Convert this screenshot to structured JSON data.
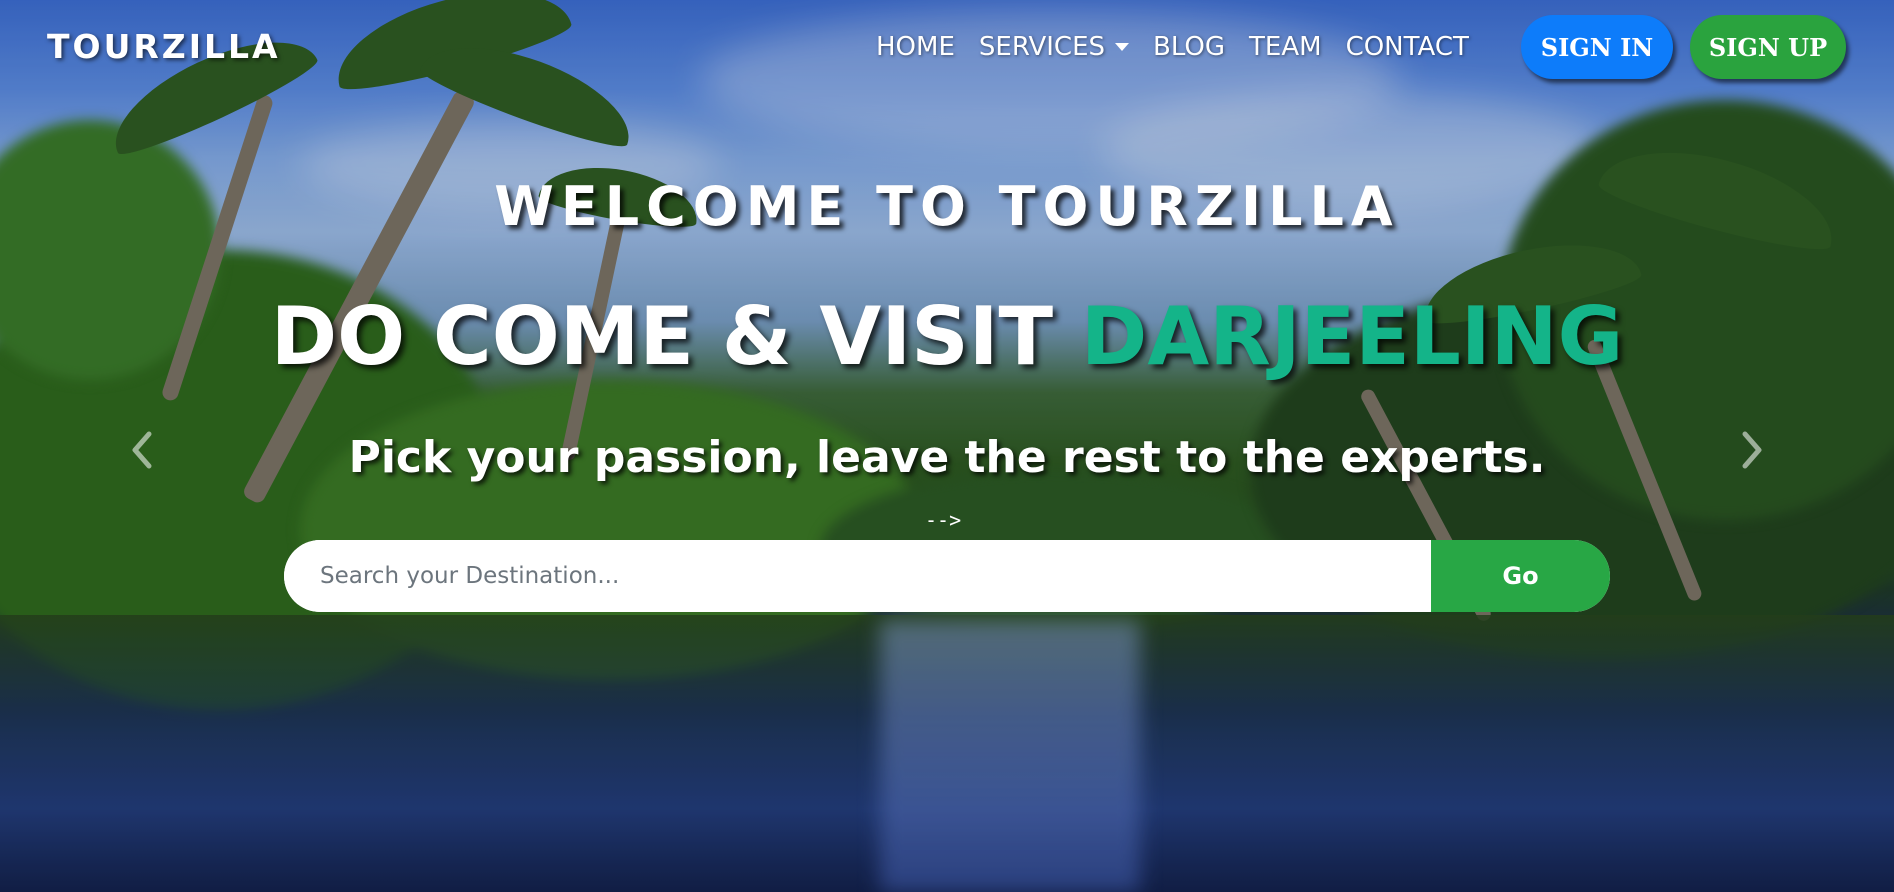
{
  "brand": "TOURZILLA",
  "nav": {
    "items": [
      {
        "label": "HOME"
      },
      {
        "label": "SERVICES"
      },
      {
        "label": "BLOG"
      },
      {
        "label": "TEAM"
      },
      {
        "label": "CONTACT"
      }
    ],
    "signin_label": "SIGN IN",
    "signup_label": "SIGN UP"
  },
  "hero": {
    "welcome": "WELCOME TO TOURZILLA",
    "headline_prefix": "DO COME & VISIT ",
    "headline_accent": "DARJEELING",
    "tagline": "Pick your passion, leave the rest to the experts.",
    "arrow_text": "-->"
  },
  "search": {
    "placeholder": "Search your Destination...",
    "value": "",
    "button_label": "Go"
  },
  "icons": {
    "prev": "chevron-left-icon",
    "next": "chevron-right-icon",
    "dropdown": "caret-down-icon"
  },
  "colors": {
    "accent": "#14b489",
    "signin": "#0d7cfa",
    "signup": "#2aa33e",
    "go_button": "#28a745"
  }
}
